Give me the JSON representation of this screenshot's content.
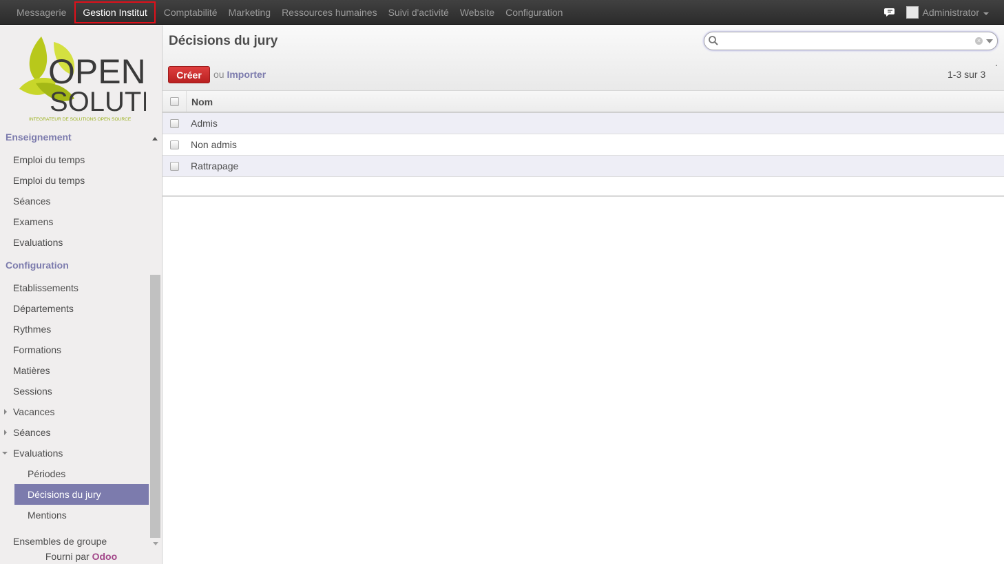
{
  "topnav": {
    "items": [
      "Messagerie",
      "Gestion Institut",
      "Comptabilité",
      "Marketing",
      "Ressources humaines",
      "Suivi d'activité",
      "Website",
      "Configuration"
    ],
    "active": "Gestion Institut",
    "user": "Administrator"
  },
  "logo": {
    "line1": "OPEN",
    "line2": "SOLUTIS",
    "tagline": "INTEGRATEUR DE SOLUTIONS OPEN SOURCE"
  },
  "sidebar": {
    "sections": [
      {
        "title": "Enseignement",
        "items": [
          "Emploi du temps",
          "Emploi du temps",
          "Séances",
          "Examens",
          "Evaluations"
        ]
      },
      {
        "title": "Configuration",
        "items": [
          "Etablissements",
          "Départements",
          "Rythmes",
          "Formations",
          "Matières",
          "Sessions",
          "Vacances",
          "Séances",
          "Evaluations",
          "Périodes",
          "Décisions du jury",
          "Mentions",
          "Ensembles de groupe"
        ]
      }
    ],
    "powered_prefix": "Fourni par",
    "powered_brand": "Odoo"
  },
  "main": {
    "title": "Décisions du jury",
    "search_value": "",
    "create_label": "Créer",
    "or_label": "ou",
    "import_label": "Importer",
    "pager": "1-3 sur 3",
    "column_header": "Nom",
    "rows": [
      "Admis",
      "Non admis",
      "Rattrapage"
    ]
  },
  "colors": {
    "accent": "#7c7bad",
    "create_button": "#c62828",
    "highlight_border": "#e0101a"
  }
}
